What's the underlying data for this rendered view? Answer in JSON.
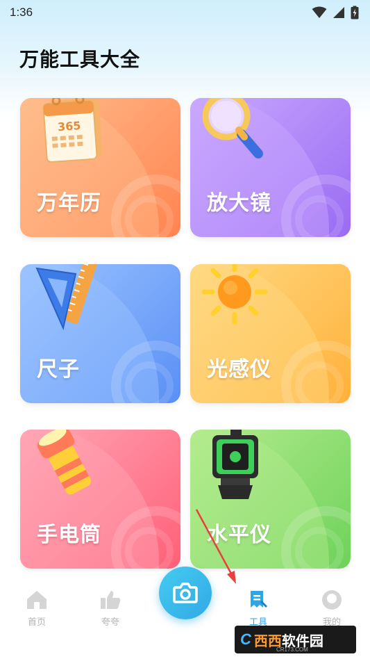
{
  "status_bar": {
    "time": "1:36",
    "icons": [
      "wifi-icon",
      "signal-icon",
      "battery-charging-icon"
    ]
  },
  "page_title": "万能工具大全",
  "tools": [
    {
      "id": "calendar",
      "label": "万年历",
      "icon": "calendar-icon",
      "calendar_number": "365",
      "colors": [
        "#ffbc8c",
        "#ff8450"
      ]
    },
    {
      "id": "magnifier",
      "label": "放大镜",
      "icon": "magnifier-icon",
      "colors": [
        "#c9a9ff",
        "#9a6bf2"
      ]
    },
    {
      "id": "ruler",
      "label": "尺子",
      "icon": "ruler-icon",
      "colors": [
        "#9cc4ff",
        "#5a8ff5"
      ]
    },
    {
      "id": "light-meter",
      "label": "光感仪",
      "icon": "sun-icon",
      "colors": [
        "#ffd983",
        "#ffb13a"
      ]
    },
    {
      "id": "flashlight",
      "label": "手电筒",
      "icon": "flashlight-icon",
      "colors": [
        "#ffa6b5",
        "#ff6078"
      ]
    },
    {
      "id": "level",
      "label": "水平仪",
      "icon": "laser-level-icon",
      "colors": [
        "#b4ec8e",
        "#6ed25a"
      ]
    }
  ],
  "bottom_nav": {
    "items": [
      {
        "label": "首页",
        "icon": "home-icon",
        "active": false
      },
      {
        "label": "夸夸",
        "icon": "thumbs-up-icon",
        "active": false
      },
      {
        "label": "工具",
        "icon": "tools-icon",
        "active": true
      },
      {
        "label": "我的",
        "icon": "profile-icon",
        "active": false
      }
    ],
    "center_button": {
      "icon": "camera-icon"
    }
  },
  "annotation": {
    "icon": "red-arrow-icon",
    "color": "#e8403c"
  },
  "watermark": {
    "logo": "C",
    "text1": "西西",
    "text2": "软件园",
    "url": "CR173.COM"
  }
}
